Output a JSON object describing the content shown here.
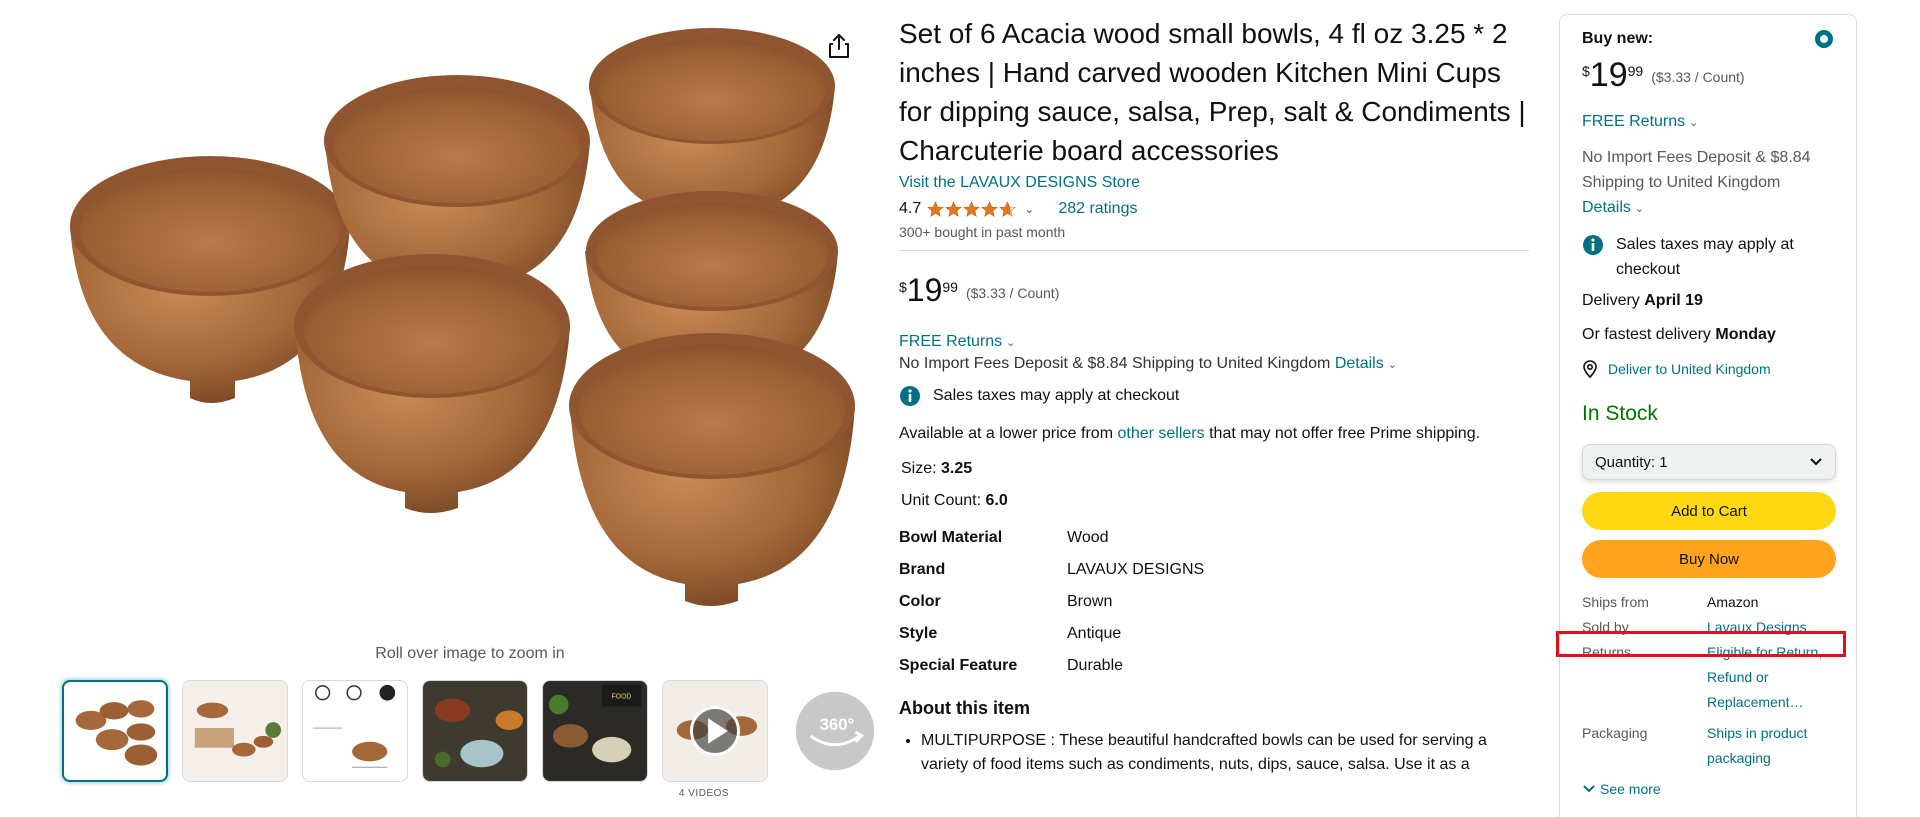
{
  "gallery": {
    "zoom_hint": "Roll over image to zoom in",
    "videos_label": "4 VIDEOS",
    "thumbnails": [
      "bowls-set",
      "bowls-with-food",
      "features-diagram",
      "bowl-with-spice",
      "food-bowls-closeup",
      "video",
      "360-view"
    ],
    "video_360_label": "360°"
  },
  "product": {
    "title": "Set of 6 Acacia wood small bowls, 4 fl oz 3.25 * 2 inches | Hand carved wooden Kitchen Mini Cups for dipping sauce, salsa, Prep, salt & Condiments | Charcuterie board accessories",
    "store_link": "Visit the LAVAUX DESIGNS Store",
    "rating": "4.7",
    "rating_stars": 4.7,
    "ratings_count": "282 ratings",
    "bought": "300+ bought in past month",
    "price": {
      "symbol": "$",
      "whole": "19",
      "fraction": "99",
      "unit": "($3.33 / Count)"
    },
    "free_returns": "FREE Returns",
    "import_fees": "No Import Fees Deposit & $8.84 Shipping to United Kingdom",
    "details_link": "Details",
    "sales_tax": "Sales taxes may apply at checkout",
    "lower_price_pre": "Available at a lower price from",
    "lower_price_link": "other sellers",
    "lower_price_post": "that may not offer free Prime shipping.",
    "size_label": "Size:",
    "size_value": "3.25",
    "unit_count_label": "Unit Count:",
    "unit_count_value": "6.0",
    "specs": [
      {
        "key": "Bowl Material",
        "value": "Wood"
      },
      {
        "key": "Brand",
        "value": "LAVAUX DESIGNS"
      },
      {
        "key": "Color",
        "value": "Brown"
      },
      {
        "key": "Style",
        "value": "Antique"
      },
      {
        "key": "Special Feature",
        "value": "Durable"
      }
    ],
    "about_title": "About this item",
    "about_items": [
      "MULTIPURPOSE : These beautiful handcrafted bowls can be used for serving a variety of food items such as condiments, nuts, dips, sauce, salsa. Use it as a"
    ]
  },
  "buybox": {
    "buy_new": "Buy new:",
    "price": {
      "symbol": "$",
      "whole": "19",
      "fraction": "99",
      "unit": "($3.33 / Count)"
    },
    "free_returns": "FREE Returns",
    "import_fees": "No Import Fees Deposit & $8.84 Shipping to United Kingdom",
    "details_link": "Details",
    "sales_tax": "Sales taxes may apply at checkout",
    "delivery_label": "Delivery",
    "delivery_date": "April 19",
    "fastest_label": "Or fastest delivery",
    "fastest_date": "Monday",
    "deliver_to": "Deliver to United Kingdom",
    "stock": "In Stock",
    "quantity": "Quantity:  1",
    "add_to_cart": "Add to Cart",
    "buy_now": "Buy Now",
    "info": [
      {
        "key": "Ships from",
        "value": "Amazon"
      },
      {
        "key": "Sold by",
        "value": "Lavaux Designs"
      },
      {
        "key": "Returns",
        "value": "Eligible for Return, Refund or Replacement…"
      },
      {
        "key": "Packaging",
        "value": "Ships in product packaging"
      }
    ],
    "see_more": "See more"
  },
  "colors": {
    "link": "#007185",
    "in_stock": "#007600",
    "cart_button": "#ffd814",
    "buy_button": "#ffa41c",
    "star": "#de7921",
    "highlight": "#e0111d"
  }
}
